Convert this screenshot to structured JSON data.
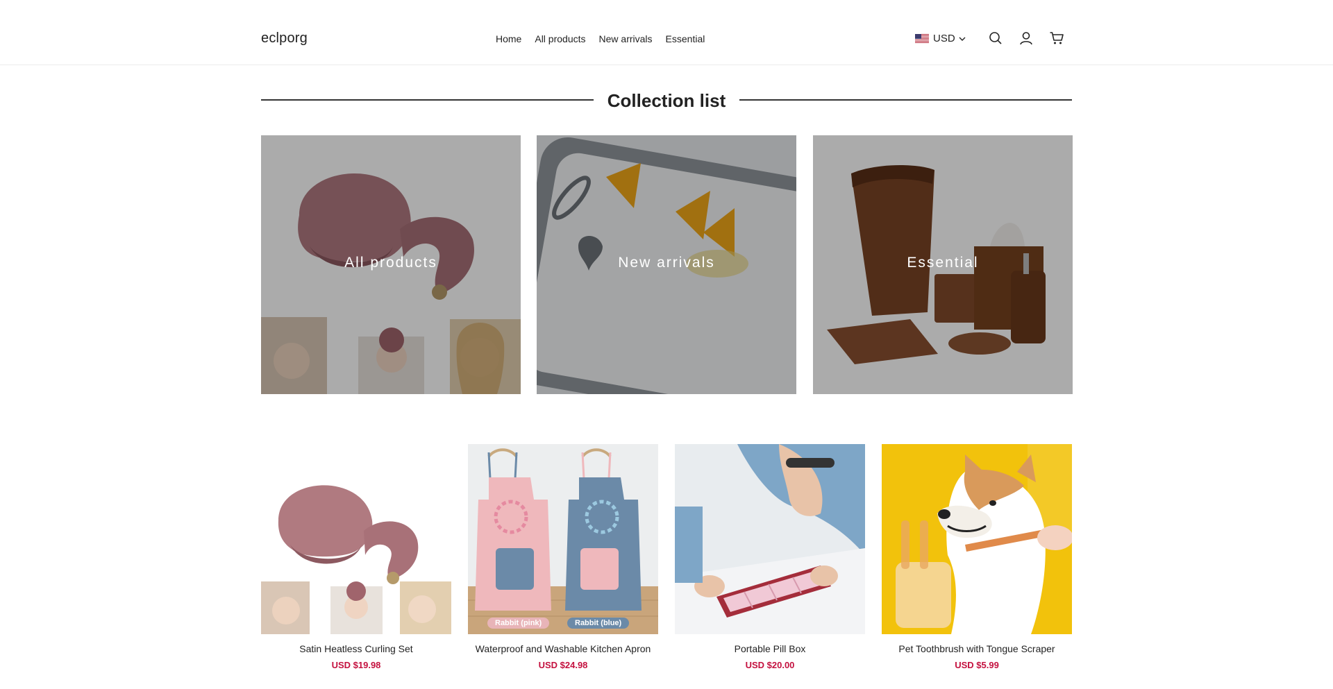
{
  "header": {
    "logo": "eclporg",
    "nav": [
      "Home",
      "All products",
      "New arrivals",
      "Essential"
    ],
    "currency": "USD",
    "icons": [
      "flag-us-icon",
      "chevron-down-icon",
      "search-icon",
      "account-icon",
      "cart-icon"
    ]
  },
  "collection": {
    "title": "Collection list",
    "cards": [
      {
        "label": "All products"
      },
      {
        "label": "New arrivals"
      },
      {
        "label": "Essential"
      }
    ]
  },
  "products": [
    {
      "title": "Satin Heatless Curling Set",
      "price": "USD $19.98"
    },
    {
      "title": "Waterproof and Washable Kitchen Apron",
      "price": "USD $24.98",
      "tags": [
        "Rabbit (pink)",
        "Rabbit (blue)"
      ]
    },
    {
      "title": "Portable Pill Box",
      "price": "USD $20.00"
    },
    {
      "title": "Pet Toothbrush with Tongue Scraper",
      "price": "USD $5.99"
    }
  ],
  "colors": {
    "price": "#c4113f",
    "accent_pink": "#e8b4b8",
    "accent_blue": "#6b8aa8"
  }
}
